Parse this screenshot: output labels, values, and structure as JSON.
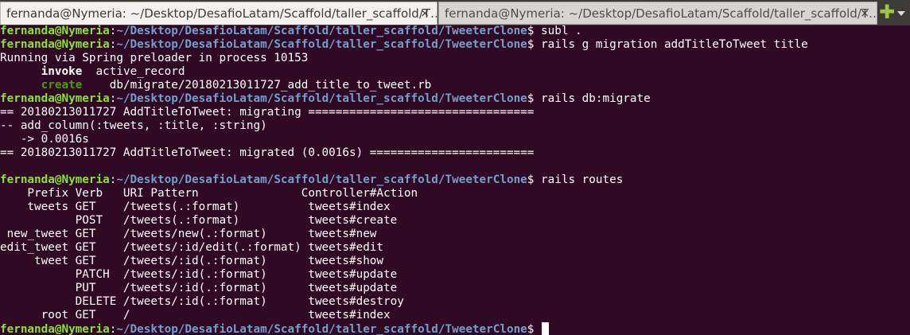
{
  "tabs": [
    {
      "title": "fernanda@Nymeria: ~/Desktop/DesafioLatam/Scaffold/taller_scaffold/T…",
      "close": "×"
    },
    {
      "title": "fernanda@Nymeria: ~/Desktop/DesafioLatam/Scaffold/taller_scaffold/T…",
      "close": "×"
    }
  ],
  "new_tab_icon": "✚",
  "prompt": {
    "user": "fernanda@Nymeria",
    "colon": ":",
    "path": "~/Desktop/DesafioLatam/Scaffold/taller_scaffold/TweeterClone",
    "symbol": "$ "
  },
  "commands": [
    "subl .",
    "rails g migration addTitleToTweet title",
    "rails db:migrate",
    "rails routes",
    ""
  ],
  "generate_output": {
    "preloader": "Running via Spring preloader in process 10153",
    "invoke_indent": "      ",
    "invoke_kw": "invoke",
    "invoke_rest": "  active_record",
    "create_indent": "      ",
    "create_kw": "create",
    "create_rest": "    db/migrate/20180213011727_add_title_to_tweet.rb"
  },
  "migrate_output": [
    "== 20180213011727 AddTitleToTweet: migrating =================================",
    "-- add_column(:tweets, :title, :string)",
    "   -> 0.0016s",
    "== 20180213011727 AddTitleToTweet: migrated (0.0016s) ========================",
    ""
  ],
  "routes_output": [
    "    Prefix Verb   URI Pattern               Controller#Action",
    "    tweets GET    /tweets(.:format)          tweets#index",
    "           POST   /tweets(.:format)          tweets#create",
    " new_tweet GET    /tweets/new(.:format)      tweets#new",
    "edit_tweet GET    /tweets/:id/edit(.:format) tweets#edit",
    "     tweet GET    /tweets/:id(.:format)      tweets#show",
    "           PATCH  /tweets/:id(.:format)      tweets#update",
    "           PUT    /tweets/:id(.:format)      tweets#update",
    "           DELETE /tweets/:id(.:format)      tweets#destroy",
    "      root GET    /                          tweets#index"
  ],
  "colors": {
    "background": "#300a24",
    "user": "#8ae234",
    "path": "#729fcf",
    "create_keyword": "#4e9a06",
    "text": "#ffffff"
  }
}
